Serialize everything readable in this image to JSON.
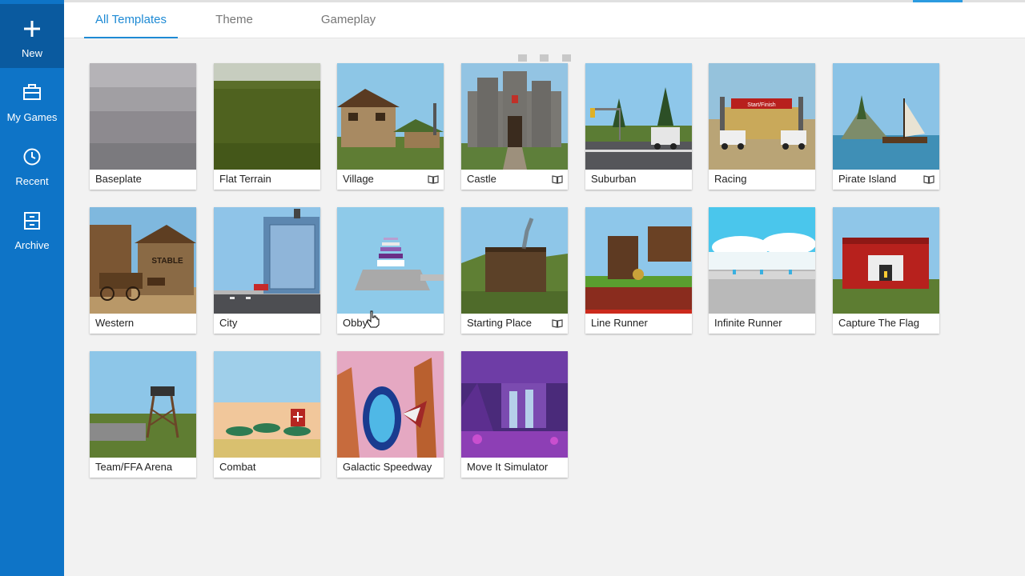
{
  "sidebar": {
    "items": [
      {
        "label": "New",
        "icon": "plus-icon"
      },
      {
        "label": "My Games",
        "icon": "briefcase-icon"
      },
      {
        "label": "Recent",
        "icon": "clock-icon"
      },
      {
        "label": "Archive",
        "icon": "archive-box-icon"
      }
    ]
  },
  "tabs": [
    {
      "label": "All Templates",
      "active": true
    },
    {
      "label": "Theme",
      "active": false
    },
    {
      "label": "Gameplay",
      "active": false
    }
  ],
  "templates": [
    {
      "name": "Baseplate",
      "tutorial": false
    },
    {
      "name": "Flat Terrain",
      "tutorial": false
    },
    {
      "name": "Village",
      "tutorial": true
    },
    {
      "name": "Castle",
      "tutorial": true
    },
    {
      "name": "Suburban",
      "tutorial": false
    },
    {
      "name": "Racing",
      "tutorial": false
    },
    {
      "name": "Pirate Island",
      "tutorial": true
    },
    {
      "name": "Western",
      "tutorial": false
    },
    {
      "name": "City",
      "tutorial": false
    },
    {
      "name": "Obby",
      "tutorial": false
    },
    {
      "name": "Starting Place",
      "tutorial": true
    },
    {
      "name": "Line Runner",
      "tutorial": false
    },
    {
      "name": "Infinite Runner",
      "tutorial": false
    },
    {
      "name": "Capture The Flag",
      "tutorial": false
    },
    {
      "name": "Team/FFA Arena",
      "tutorial": false
    },
    {
      "name": "Combat",
      "tutorial": false
    },
    {
      "name": "Galactic Speedway",
      "tutorial": false
    },
    {
      "name": "Move It Simulator",
      "tutorial": false
    }
  ],
  "thumb_text": {
    "stable_sign": "STABLE",
    "racing_banner": "Start/Finish"
  },
  "colors": {
    "sidebar": "#0e74c7",
    "sidebar_active": "#0a5a9f",
    "tab_active": "#1e8ad4",
    "background": "#f2f2f2"
  }
}
